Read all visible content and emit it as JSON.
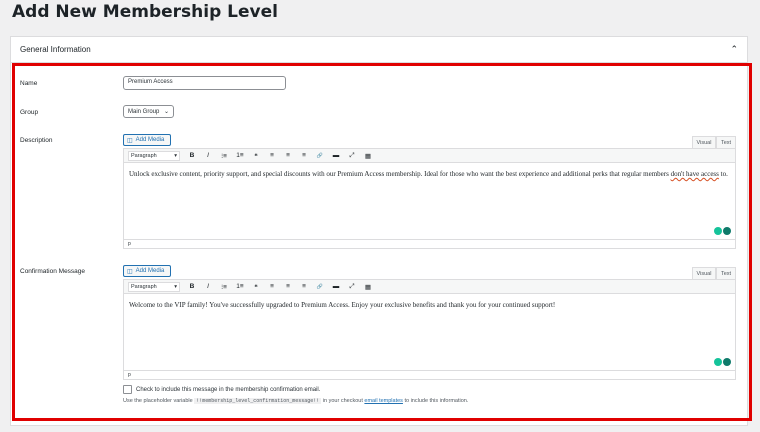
{
  "page": {
    "title": "Add New Membership Level"
  },
  "panel": {
    "title": "General Information"
  },
  "fields": {
    "name": {
      "label": "Name",
      "value": "Premium Access"
    },
    "group": {
      "label": "Group",
      "value": "Main Group"
    },
    "description": {
      "label": "Description"
    },
    "confirmation": {
      "label": "Confirmation Message"
    }
  },
  "editor": {
    "add_media": "Add Media",
    "tab_visual": "Visual",
    "tab_text": "Text",
    "format": "Paragraph",
    "toolbar_buttons": [
      "B",
      "I",
      "⁝≡",
      "1≡",
      "❝",
      "≡",
      "≡",
      "≡",
      "🔗",
      "▬",
      "⤢",
      "▦"
    ],
    "status_path": "p"
  },
  "description_text": {
    "part1": "Unlock exclusive content, priority support, and special discounts with our Premium Access membership. Ideal for those who want the best experience and additional perks that regular members ",
    "flagged": "don't have access",
    "part2": " to."
  },
  "confirmation_text": "Welcome to the VIP family! You've successfully upgraded to Premium Access. Enjoy your exclusive benefits and thank you for your continued support!",
  "checkbox": {
    "label": "Check to include this message in the membership confirmation email."
  },
  "help": {
    "before": "Use the placeholder variable",
    "code": "!!membership_level_confirmation_message!!",
    "middle": "in your checkout",
    "link": "email templates",
    "after": "to include this information."
  },
  "colors": {
    "accent": "#2271b1",
    "highlight_border": "#e00000",
    "grammarly_green": "#15c39a",
    "grammarly_teal": "#0e7a6a"
  }
}
